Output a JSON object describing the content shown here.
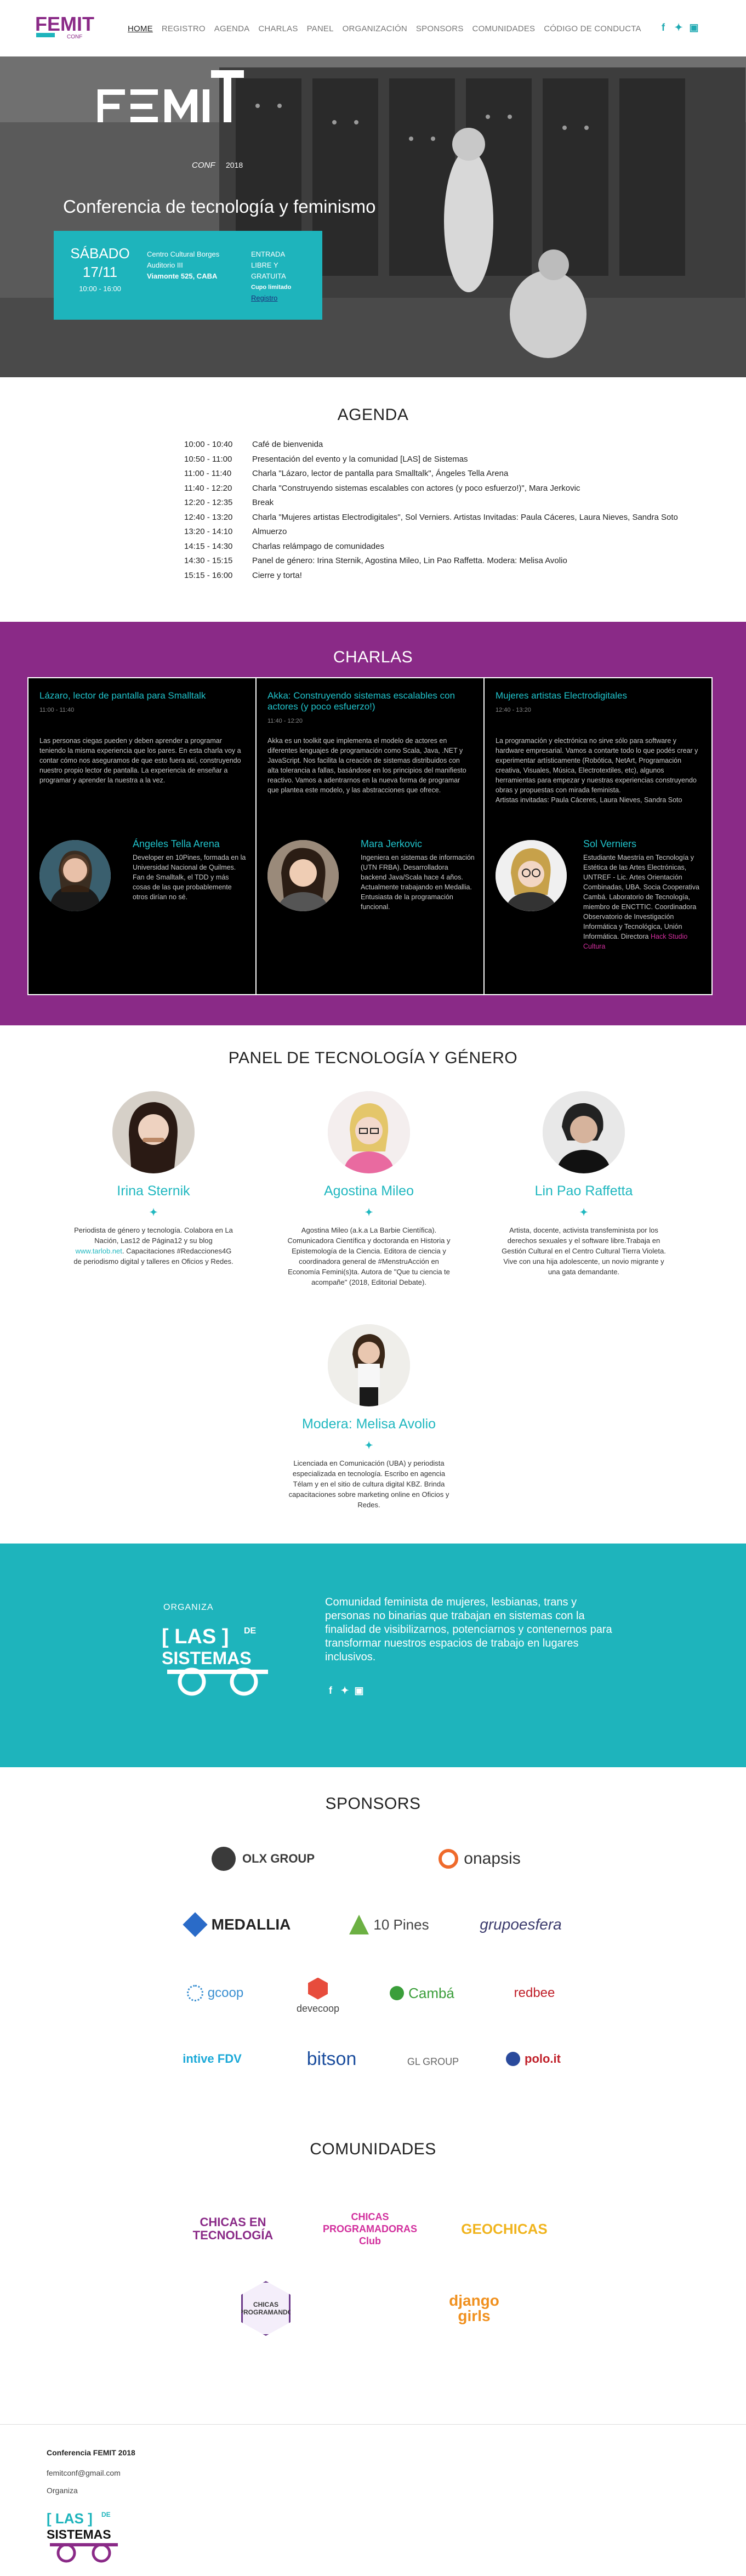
{
  "nav": {
    "logo_text": "FEMIT",
    "logo_sub": "CONF",
    "links": [
      "HOME",
      "REGISTRO",
      "AGENDA",
      "CHARLAS",
      "PANEL",
      "ORGANIZACIÓN",
      "SPONSORS",
      "COMUNIDADES",
      "CÓDIGO DE CONDUCTA"
    ],
    "social": [
      "facebook-icon",
      "twitter-icon",
      "instagram-icon"
    ]
  },
  "hero": {
    "logo_text": "FEMIT",
    "logo_conf": "CONF",
    "logo_year": "2018",
    "title": "Conferencia de tecnología y feminismo",
    "day": "SÁBADO",
    "date": "17/11",
    "time": "10:00 - 16:00",
    "venue": "Centro Cultural Borges",
    "room": "Auditorio III",
    "address": "Viamonte 525, CABA",
    "entry_1": "ENTRADA",
    "entry_2": "LIBRE Y",
    "entry_3": "GRATUITA",
    "entry_4": "Cupo limitado",
    "entry_link": "Registro"
  },
  "agenda": {
    "title": "AGENDA",
    "items": [
      {
        "time": "10:00 - 10:40",
        "text": "Café de bienvenida"
      },
      {
        "time": "10:50 - 11:00",
        "text": "Presentación del evento y la comunidad [LAS] de Sistemas"
      },
      {
        "time": "11:00 - 11:40",
        "text": "Charla \"Lázaro, lector de pantalla para Smalltalk\", Ángeles Tella Arena"
      },
      {
        "time": "11:40 - 12:20",
        "text": "Charla \"Construyendo sistemas escalables con actores (y poco esfuerzo!)\", Mara Jerkovic"
      },
      {
        "time": "12:20 - 12:35",
        "text": "Break"
      },
      {
        "time": "12:40 - 13:20",
        "text": "Charla \"Mujeres artistas Electrodigitales\", Sol Verniers. Artistas Invitadas: Paula Cáceres, Laura Nieves, Sandra Soto"
      },
      {
        "time": "13:20 - 14:10",
        "text": "Almuerzo"
      },
      {
        "time": "14:15 - 14:30",
        "text": "Charlas relámpago de comunidades"
      },
      {
        "time": "14:30 - 15:15",
        "text": "Panel de género: Irina Sternik, Agostina Mileo, Lin Pao Raffetta. Modera: Melisa Avolio"
      },
      {
        "time": "15:15 - 16:00",
        "text": "Cierre y torta!"
      }
    ]
  },
  "charlas": {
    "title": "CHARLAS",
    "items": [
      {
        "title": "Lázaro, lector de pantalla para Smalltalk",
        "time": "11:00 - 11:40",
        "desc": "Las personas ciegas pueden y deben aprender a programar teniendo la misma experiencia que los pares. En esta charla voy a contar cómo nos aseguramos de que esto fuera así, construyendo nuestro propio lector de pantalla. La experiencia de enseñar a programar y aprender la nuestra a la vez.",
        "speaker": "Ángeles Tella Arena",
        "bio": "Developer en 10Pines, formada en la Universidad Nacional de Quilmes. Fan de Smalltalk, el TDD y más cosas de las que probablemente otros dirían no sé."
      },
      {
        "title": "Akka: Construyendo sistemas escalables con actores (y poco esfuerzo!)",
        "time": "11:40 - 12:20",
        "desc": "Akka es un toolkit que implementa el modelo de actores en diferentes lenguajes de programación como Scala, Java, .NET y JavaScript. Nos facilita la creación de sistemas distribuidos con alta tolerancia a fallas, basándose en los principios del manifiesto reactivo. Vamos a adentrarnos en la nueva forma de programar que plantea este modelo, y las abstracciones que ofrece.",
        "speaker": "Mara Jerkovic",
        "bio": "Ingeniera en sistemas de información (UTN FRBA). Desarrolladora backend Java/Scala hace 4 años. Actualmente trabajando en Medallia. Entusiasta de la programación funcional."
      },
      {
        "title": "Mujeres artistas Electrodigitales",
        "time": "12:40 - 13:20",
        "desc": "La programación y electrónica no sirve sólo para software y hardware empresarial. Vamos a contarte todo lo que podés crear y experimentar artísticamente (Robótica, NetArt, Programación creativa, Visuales, Música, Electrotextiles, etc), algunos herramientas para empezar y nuestras experiencias construyendo obras y propuestas con mirada feminista.",
        "desc2": "Artistas invitadas: Paula Cáceres, Laura Nieves, Sandra Soto",
        "speaker": "Sol Verniers",
        "bio": "Estudiante Maestría en Tecnología y Estética de las Artes Electrónicas, UNTREF - Lic. Artes Orientación Combinadas, UBA. Socia Cooperativa Cambá. Laboratorio de Tecnología, miembro de ENCTTIC. Coordinadora Observatorio de Investigación Informática y Tecnológica, Unión Informática. Directora",
        "bio_link": "Hack Studio Cultura"
      }
    ]
  },
  "panel": {
    "title": "PANEL DE TECNOLOGÍA Y GÉNERO",
    "members": [
      {
        "name": "Irina Sternik",
        "bio": "Periodista de género y tecnología. Colabora en La Nación, Las12 de Página12 y su blog",
        "bio_link": "www.tarlob.net",
        "bio_end": ". Capacitaciones #Redacciones4G de periodismo digital y talleres en Oficios y Redes."
      },
      {
        "name": "Agostina Mileo",
        "bio": "Agostina Mileo (a.k.a La Barbie Científica). Comunicadora Científica y doctoranda en Historia y Epistemología de la Ciencia. Editora de ciencia y coordinadora general de #MenstruAcción en Economía Femini(s)ta. Autora de \"Que tu ciencia te acompañe\" (2018, Editorial Debate)."
      },
      {
        "name": "Lin Pao Raffetta",
        "bio": "Artista, docente, activista transfeminista por los derechos sexuales y el software libre.Trabaja en Gestión Cultural en el Centro Cultural Tierra Violeta. Vive con una hija adolescente, un novio migrante y una gata demandante."
      },
      {
        "name": "Modera: Melisa Avolio",
        "bio": "Licenciada en Comunicación (UBA) y periodista especializada en tecnología. Escribo en agencia Télam y en el sitio de cultura digital KBZ. Brinda capacitaciones sobre marketing online en Oficios y Redes."
      }
    ]
  },
  "organiza": {
    "label": "ORGANIZA",
    "logo_las": "[ LAS ]",
    "logo_de": "DE",
    "logo_sistemas": "SISTEMAS",
    "text": "Comunidad feminista de mujeres, lesbianas, trans y personas no binarias que trabajan en sistemas con la finalidad de visibilizarnos, potenciarnos y contenernos para transformar nuestros espacios de trabajo en lugares inclusivos."
  },
  "sponsors": {
    "title": "SPONSORS",
    "logos": [
      "OLX GROUP",
      "onapsis",
      "MEDALLIA",
      "10 Pines",
      "grupoesfera",
      "gcoop",
      "devecoop",
      "Cambá",
      "redbee",
      "intive FDV",
      "bitson",
      "GL GROUP",
      "polo.it"
    ]
  },
  "comunidades": {
    "title": "COMUNIDADES",
    "logos": [
      "CHICAS EN TECNOLOGÍA",
      "CHICAS PROGRAMADORAS Club",
      "GEOCHICAS",
      "CHICAS PROGRAMANDO",
      "django girls"
    ]
  },
  "footer": {
    "title": "Conferencia FEMIT 2018",
    "email": "femitconf@gmail.com",
    "org": "Organiza",
    "logo_las": "[ LAS ]",
    "logo_de": "DE",
    "logo_sistemas": "SISTEMAS"
  },
  "colors": {
    "accent": "#1eb4bc",
    "purple": "#8a2a87",
    "pink": "#d22f9d"
  }
}
